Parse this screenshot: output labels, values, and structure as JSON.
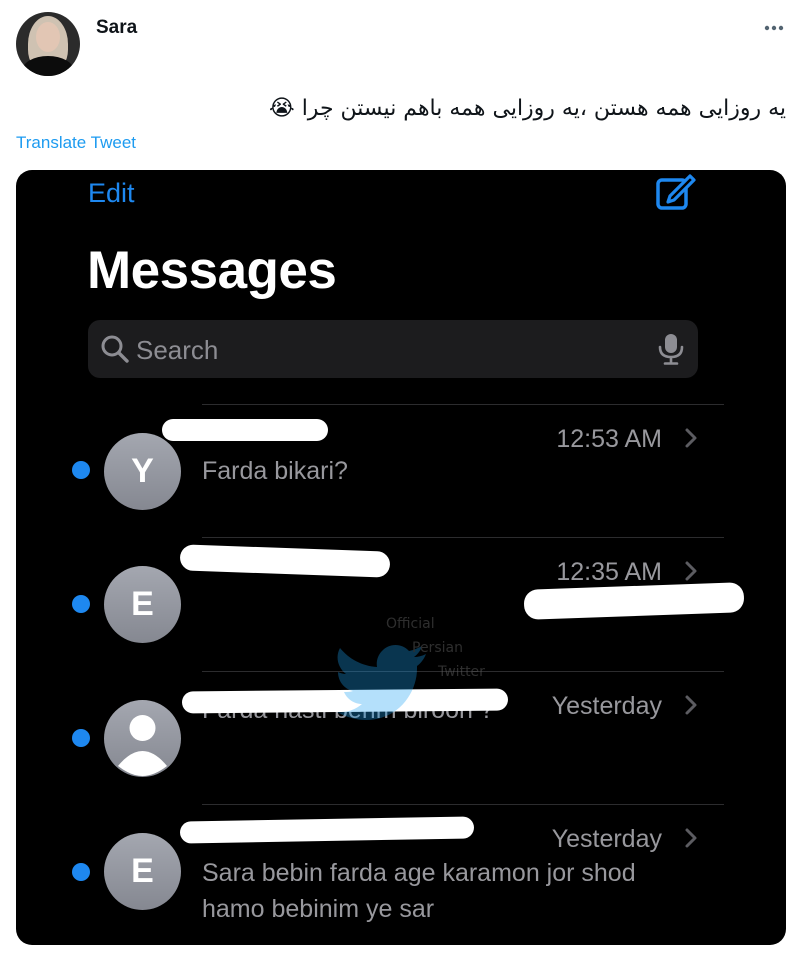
{
  "tweet": {
    "author": "Sara",
    "text": "یه روزایی همه هستن ،یه روزایی همه باهم نیستن چرا 😭",
    "translate_label": "Translate Tweet"
  },
  "ios": {
    "edit_label": "Edit",
    "title": "Messages",
    "search_placeholder": "Search",
    "messages": [
      {
        "initial": "Y",
        "time": "12:53 AM",
        "preview": "Farda bikari?"
      },
      {
        "initial": "E",
        "time": "12:35 AM",
        "preview": ""
      },
      {
        "initial": "",
        "time": "Yesterday",
        "preview": "Farda hasti berim biroon ?"
      },
      {
        "initial": "E",
        "time": "Yesterday",
        "preview": "Sara bebin farda age karamon jor shod hamo bebinim ye sar"
      }
    ]
  },
  "watermark": {
    "line1": "Official",
    "line2": "Persian",
    "line3": "Twitter"
  },
  "colors": {
    "accent": "#1d9bf0",
    "ios_blue": "#1e88f0",
    "ios_background": "#000000",
    "ios_secondary_text": "#98989d"
  }
}
